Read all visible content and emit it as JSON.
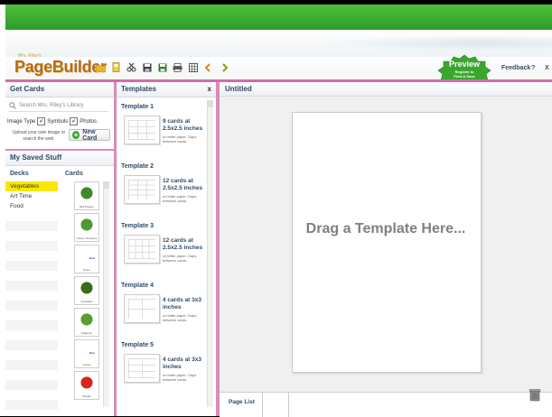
{
  "app": {
    "brand_tag": "Mrs. Riley's",
    "brand": "PageBuilder",
    "preview": {
      "title": "Preview",
      "sub": "Register to Print & Save"
    },
    "feedback": "Feedback",
    "help": "?",
    "close": "X"
  },
  "toolbar": {
    "icons": [
      "yellow-folder-icon",
      "card-icon",
      "scissors-icon",
      "save-icon",
      "save-all-icon",
      "print-icon",
      "grid-icon",
      "undo-icon",
      "redo-icon"
    ]
  },
  "left": {
    "title": "Get Cards",
    "search_placeholder": "Search Mrs. Riley's Library",
    "image_type_label": "Image Type",
    "symbols_label": "Symbols",
    "photos_label": "Photos",
    "upload_text": "Upload your own image or search the web.",
    "new_card": "New Card",
    "saved_title": "My Saved Stuff",
    "decks_col": "Decks",
    "cards_col": "Cards",
    "decks": [
      "Vegetables",
      "Art Time",
      "Food"
    ],
    "cards": [
      {
        "caption": "Bell Pepper",
        "color": "#3d8a2a"
      },
      {
        "caption": "Cherry Tomatoes",
        "color": "#4e9a32"
      },
      {
        "caption": "Onion",
        "color": "#ffffff"
      },
      {
        "caption": "Avocados",
        "color": "#3f6a1e"
      },
      {
        "caption": "Jalapeno",
        "color": "#5a9d2e"
      },
      {
        "caption": "Lettuce",
        "color": "#ffffff"
      },
      {
        "caption": "Tomato",
        "color": "#d6261d"
      }
    ]
  },
  "templates": {
    "title": "Templates",
    "close": "x",
    "items": [
      {
        "title": "Template 1",
        "desc": "9 cards at 2.5x2.5 inches",
        "note": "on letter paper. Gaps between cards."
      },
      {
        "title": "Template 2",
        "desc": "12 cards at 2.5x2.5 inches",
        "note": "on letter paper. Gaps between cards."
      },
      {
        "title": "Template 3",
        "desc": "12 cards at 2.5x2.5 inches",
        "note": "on letter paper. Gaps between cards."
      },
      {
        "title": "Template 4",
        "desc": "4 cards at 3x3 inches",
        "note": "on letter paper. Gaps between cards."
      },
      {
        "title": "Template 5",
        "desc": "4 cards at 3x3 inches",
        "note": "on letter paper. Gaps between cards."
      }
    ]
  },
  "canvas": {
    "title": "Untitled",
    "drag_text": "Drag a Template Here...",
    "page_list": "Page List"
  },
  "colors": {
    "accent_pink": "#cf6fa9",
    "top_green": "#3aaa32",
    "selected_yellow": "#fbe800",
    "heading_blue": "#2f4a66"
  }
}
